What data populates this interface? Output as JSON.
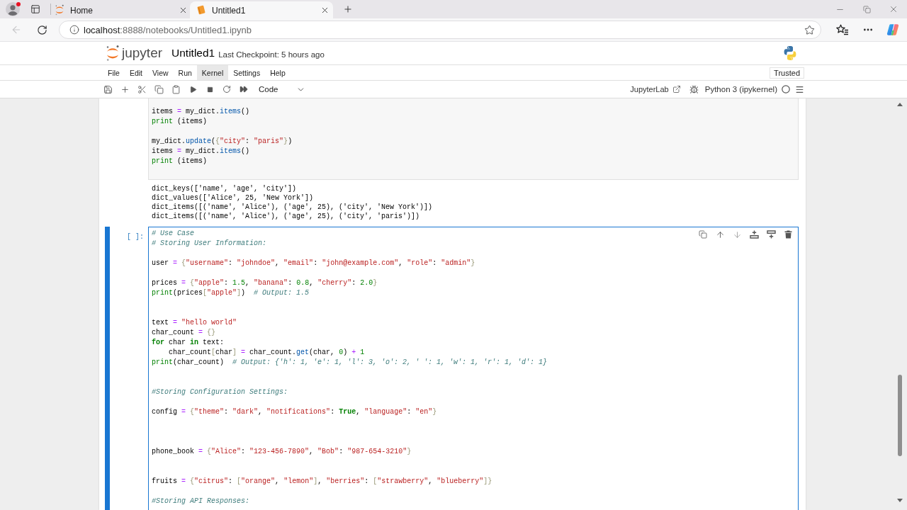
{
  "browser": {
    "tabs": [
      {
        "kind": "jupyter",
        "title": "Home",
        "selected": false
      },
      {
        "kind": "notebook",
        "title": "Untitled1",
        "selected": true
      }
    ],
    "back_disabled": true,
    "address": {
      "host": "localhost",
      "path": ":8888/notebooks/Untitled1.ipynb"
    }
  },
  "jupyter": {
    "logo_text": "jupyter",
    "notebook_title": "Untitled1",
    "checkpoint": "Last Checkpoint: 5 hours ago",
    "menu": [
      {
        "label": "File",
        "selected": false
      },
      {
        "label": "Edit",
        "selected": false
      },
      {
        "label": "View",
        "selected": false
      },
      {
        "label": "Run",
        "selected": false
      },
      {
        "label": "Kernel",
        "selected": true
      },
      {
        "label": "Settings",
        "selected": false
      },
      {
        "label": "Help",
        "selected": false
      }
    ],
    "trusted": "Trusted",
    "toolbar": {
      "cell_type": "Code",
      "jupyterlab_link": "JupyterLab",
      "kernel": "Python 3 (ipykernel)",
      "kernel_busy": false
    }
  },
  "cells": [
    {
      "active": false,
      "source": [
        {
          "kind": "code",
          "tokens": [
            {
              "kind": "name",
              "text": "items "
            },
            {
              "kind": "operator",
              "text": "="
            },
            {
              "kind": "name",
              "text": " my_dict."
            },
            {
              "kind": "property",
              "text": "items"
            },
            {
              "kind": "name",
              "text": "()"
            }
          ]
        },
        {
          "kind": "code",
          "tokens": [
            {
              "kind": "builtin",
              "text": "print"
            },
            {
              "kind": "name",
              "text": " (items)"
            }
          ]
        },
        {
          "kind": "blank"
        },
        {
          "kind": "code",
          "tokens": [
            {
              "kind": "name",
              "text": "my_dict."
            },
            {
              "kind": "property",
              "text": "update"
            },
            {
              "kind": "name",
              "text": "("
            },
            {
              "kind": "bracket",
              "text": "{"
            },
            {
              "kind": "string",
              "text": "\"city\""
            },
            {
              "kind": "name",
              "text": ": "
            },
            {
              "kind": "string",
              "text": "\"paris\""
            },
            {
              "kind": "bracket",
              "text": "}"
            },
            {
              "kind": "name",
              "text": ")"
            }
          ]
        },
        {
          "kind": "code",
          "tokens": [
            {
              "kind": "name",
              "text": "items "
            },
            {
              "kind": "operator",
              "text": "="
            },
            {
              "kind": "name",
              "text": " my_dict."
            },
            {
              "kind": "property",
              "text": "items"
            },
            {
              "kind": "name",
              "text": "()"
            }
          ]
        },
        {
          "kind": "code",
          "tokens": [
            {
              "kind": "builtin",
              "text": "print"
            },
            {
              "kind": "name",
              "text": " (items)"
            }
          ]
        }
      ],
      "outputs": [
        "dict_keys(['name', 'age', 'city'])",
        "dict_values(['Alice', 25, 'New York'])",
        "dict_items([('name', 'Alice'), ('age', 25), ('city', 'New York')])",
        "dict_items([('name', 'Alice'), ('age', 25), ('city', 'paris')])"
      ]
    },
    {
      "active": true,
      "prompt": "[ ]:",
      "source": [
        {
          "kind": "code",
          "tokens": [
            {
              "kind": "comment",
              "text": "# Use Case"
            }
          ]
        },
        {
          "kind": "code",
          "tokens": [
            {
              "kind": "comment",
              "text": "# Storing User Information:"
            }
          ]
        },
        {
          "kind": "blank"
        },
        {
          "kind": "code",
          "tokens": [
            {
              "kind": "name",
              "text": "user "
            },
            {
              "kind": "operator",
              "text": "= "
            },
            {
              "kind": "bracket",
              "text": "{"
            },
            {
              "kind": "string",
              "text": "\"username\""
            },
            {
              "kind": "name",
              "text": ": "
            },
            {
              "kind": "string",
              "text": "\"johndoe\""
            },
            {
              "kind": "name",
              "text": ", "
            },
            {
              "kind": "string",
              "text": "\"email\""
            },
            {
              "kind": "name",
              "text": ": "
            },
            {
              "kind": "string",
              "text": "\"john@example.com\""
            },
            {
              "kind": "name",
              "text": ", "
            },
            {
              "kind": "string",
              "text": "\"role\""
            },
            {
              "kind": "name",
              "text": ": "
            },
            {
              "kind": "string",
              "text": "\"admin\""
            },
            {
              "kind": "bracket",
              "text": "}"
            }
          ]
        },
        {
          "kind": "blank"
        },
        {
          "kind": "code",
          "tokens": [
            {
              "kind": "name",
              "text": "prices "
            },
            {
              "kind": "operator",
              "text": "= "
            },
            {
              "kind": "bracket",
              "text": "{"
            },
            {
              "kind": "string",
              "text": "\"apple\""
            },
            {
              "kind": "name",
              "text": ": "
            },
            {
              "kind": "number",
              "text": "1.5"
            },
            {
              "kind": "name",
              "text": ", "
            },
            {
              "kind": "string",
              "text": "\"banana\""
            },
            {
              "kind": "name",
              "text": ": "
            },
            {
              "kind": "number",
              "text": "0.8"
            },
            {
              "kind": "name",
              "text": ", "
            },
            {
              "kind": "string",
              "text": "\"cherry\""
            },
            {
              "kind": "name",
              "text": ": "
            },
            {
              "kind": "number",
              "text": "2.0"
            },
            {
              "kind": "bracket",
              "text": "}"
            }
          ]
        },
        {
          "kind": "code",
          "tokens": [
            {
              "kind": "builtin",
              "text": "print"
            },
            {
              "kind": "name",
              "text": "(prices"
            },
            {
              "kind": "bracket",
              "text": "["
            },
            {
              "kind": "string",
              "text": "\"apple\""
            },
            {
              "kind": "bracket",
              "text": "]"
            },
            {
              "kind": "name",
              "text": ")  "
            },
            {
              "kind": "comment",
              "text": "# Output: 1.5"
            }
          ]
        },
        {
          "kind": "blank"
        },
        {
          "kind": "blank"
        },
        {
          "kind": "code",
          "tokens": [
            {
              "kind": "name",
              "text": "text "
            },
            {
              "kind": "operator",
              "text": "= "
            },
            {
              "kind": "string",
              "text": "\"hello world\""
            }
          ]
        },
        {
          "kind": "code",
          "tokens": [
            {
              "kind": "name",
              "text": "char_count "
            },
            {
              "kind": "operator",
              "text": "= "
            },
            {
              "kind": "bracket",
              "text": "{}"
            }
          ]
        },
        {
          "kind": "code",
          "tokens": [
            {
              "kind": "keyword",
              "text": "for"
            },
            {
              "kind": "name",
              "text": " char "
            },
            {
              "kind": "keyword",
              "text": "in"
            },
            {
              "kind": "name",
              "text": " text:"
            }
          ]
        },
        {
          "kind": "code",
          "tokens": [
            {
              "kind": "name",
              "text": "    char_count"
            },
            {
              "kind": "bracket",
              "text": "["
            },
            {
              "kind": "name",
              "text": "char"
            },
            {
              "kind": "bracket",
              "text": "]"
            },
            {
              "kind": "operator",
              "text": " = "
            },
            {
              "kind": "name",
              "text": "char_count."
            },
            {
              "kind": "property",
              "text": "get"
            },
            {
              "kind": "name",
              "text": "(char, "
            },
            {
              "kind": "number",
              "text": "0"
            },
            {
              "kind": "name",
              "text": ")"
            },
            {
              "kind": "operator",
              "text": " + "
            },
            {
              "kind": "number",
              "text": "1"
            }
          ]
        },
        {
          "kind": "code",
          "tokens": [
            {
              "kind": "builtin",
              "text": "print"
            },
            {
              "kind": "name",
              "text": "(char_count)  "
            },
            {
              "kind": "comment",
              "text": "# Output: {'h': 1, 'e': 1, 'l': 3, 'o': 2, ' ': 1, 'w': 1, 'r': 1, 'd': 1}"
            }
          ]
        },
        {
          "kind": "blank"
        },
        {
          "kind": "blank"
        },
        {
          "kind": "code",
          "tokens": [
            {
              "kind": "comment",
              "text": "#Storing Configuration Settings:"
            }
          ]
        },
        {
          "kind": "blank"
        },
        {
          "kind": "code",
          "tokens": [
            {
              "kind": "name",
              "text": "config "
            },
            {
              "kind": "operator",
              "text": "= "
            },
            {
              "kind": "bracket",
              "text": "{"
            },
            {
              "kind": "string",
              "text": "\"theme\""
            },
            {
              "kind": "name",
              "text": ": "
            },
            {
              "kind": "string",
              "text": "\"dark\""
            },
            {
              "kind": "name",
              "text": ", "
            },
            {
              "kind": "string",
              "text": "\"notifications\""
            },
            {
              "kind": "name",
              "text": ": "
            },
            {
              "kind": "keyword",
              "text": "True"
            },
            {
              "kind": "name",
              "text": ", "
            },
            {
              "kind": "string",
              "text": "\"language\""
            },
            {
              "kind": "name",
              "text": ": "
            },
            {
              "kind": "string",
              "text": "\"en\""
            },
            {
              "kind": "bracket",
              "text": "}"
            }
          ]
        },
        {
          "kind": "blank"
        },
        {
          "kind": "blank"
        },
        {
          "kind": "blank"
        },
        {
          "kind": "code",
          "tokens": [
            {
              "kind": "name",
              "text": "phone_book "
            },
            {
              "kind": "operator",
              "text": "= "
            },
            {
              "kind": "bracket",
              "text": "{"
            },
            {
              "kind": "string",
              "text": "\"Alice\""
            },
            {
              "kind": "name",
              "text": ": "
            },
            {
              "kind": "string",
              "text": "\"123-456-7890\""
            },
            {
              "kind": "name",
              "text": ", "
            },
            {
              "kind": "string",
              "text": "\"Bob\""
            },
            {
              "kind": "name",
              "text": ": "
            },
            {
              "kind": "string",
              "text": "\"987-654-3210\""
            },
            {
              "kind": "bracket",
              "text": "}"
            }
          ]
        },
        {
          "kind": "blank"
        },
        {
          "kind": "blank"
        },
        {
          "kind": "code",
          "tokens": [
            {
              "kind": "name",
              "text": "fruits "
            },
            {
              "kind": "operator",
              "text": "= "
            },
            {
              "kind": "bracket",
              "text": "{"
            },
            {
              "kind": "string",
              "text": "\"citrus\""
            },
            {
              "kind": "name",
              "text": ": "
            },
            {
              "kind": "bracket",
              "text": "["
            },
            {
              "kind": "string",
              "text": "\"orange\""
            },
            {
              "kind": "name",
              "text": ", "
            },
            {
              "kind": "string",
              "text": "\"lemon\""
            },
            {
              "kind": "bracket",
              "text": "]"
            },
            {
              "kind": "name",
              "text": ", "
            },
            {
              "kind": "string",
              "text": "\"berries\""
            },
            {
              "kind": "name",
              "text": ": "
            },
            {
              "kind": "bracket",
              "text": "["
            },
            {
              "kind": "string",
              "text": "\"strawberry\""
            },
            {
              "kind": "name",
              "text": ", "
            },
            {
              "kind": "string",
              "text": "\"blueberry\""
            },
            {
              "kind": "bracket",
              "text": "]"
            },
            {
              "kind": "bracket",
              "text": "}"
            }
          ]
        },
        {
          "kind": "blank"
        },
        {
          "kind": "code",
          "tokens": [
            {
              "kind": "comment",
              "text": "#Storing API Responses:"
            }
          ]
        }
      ]
    }
  ]
}
